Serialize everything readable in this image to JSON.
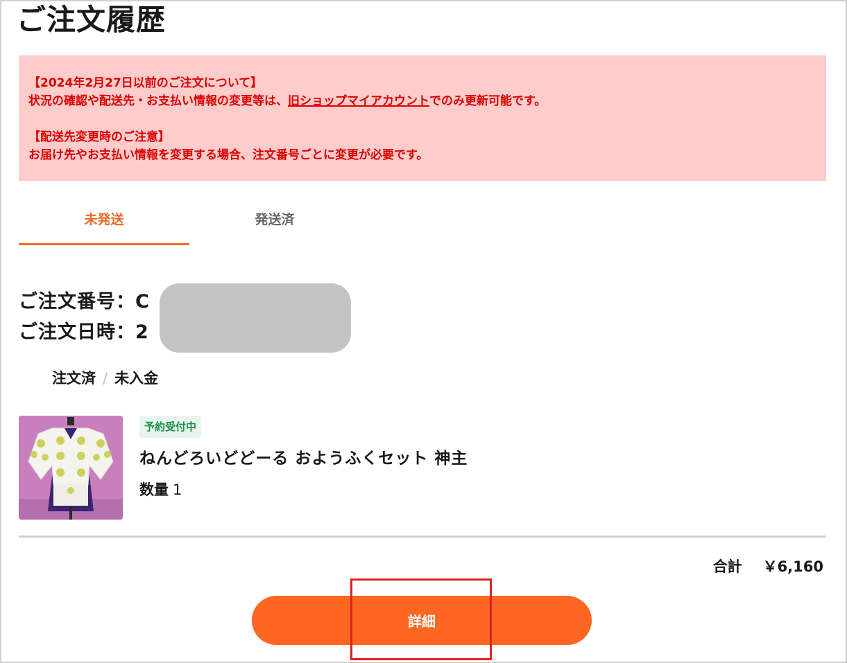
{
  "page": {
    "title": "ご注文履歴"
  },
  "notice": {
    "line1": "【2024年2月27日以前のご注文について】",
    "line2_before": "状況の確認や配送先・お支払い情報の変更等は、",
    "line2_link": "旧ショップマイアカウント",
    "line2_after": "でのみ更新可能です。",
    "line3": "【配送先変更時のご注意】",
    "line4": "お届け先やお支払い情報を変更する場合、注文番号ごとに変更が必要です。",
    "background_color": "#ffcccc",
    "text_color": "#dd0000"
  },
  "tabs": [
    {
      "label": "未発送",
      "active": true
    },
    {
      "label": "発送済",
      "active": false
    }
  ],
  "order": {
    "number_label": "ご注文番号：",
    "number_visible": "C",
    "date_label": "ご注文日時：",
    "date_visible": "2",
    "status_order": "注文済",
    "status_separator": "/",
    "status_payment": "未入金",
    "item": {
      "badge": "予約受付中",
      "name": "ねんどろいどどーる おようふくセット 神主",
      "quantity_label": "数量",
      "quantity": "1"
    },
    "total_label": "合計",
    "total_value": "￥6,160"
  },
  "actions": {
    "detail_label": "詳細"
  },
  "colors": {
    "accent": "#ff6622",
    "tab_active": "#ee6b24",
    "badge_bg": "#e8f5ec",
    "badge_text": "#1a8f4a",
    "highlight": "#dd2222"
  }
}
